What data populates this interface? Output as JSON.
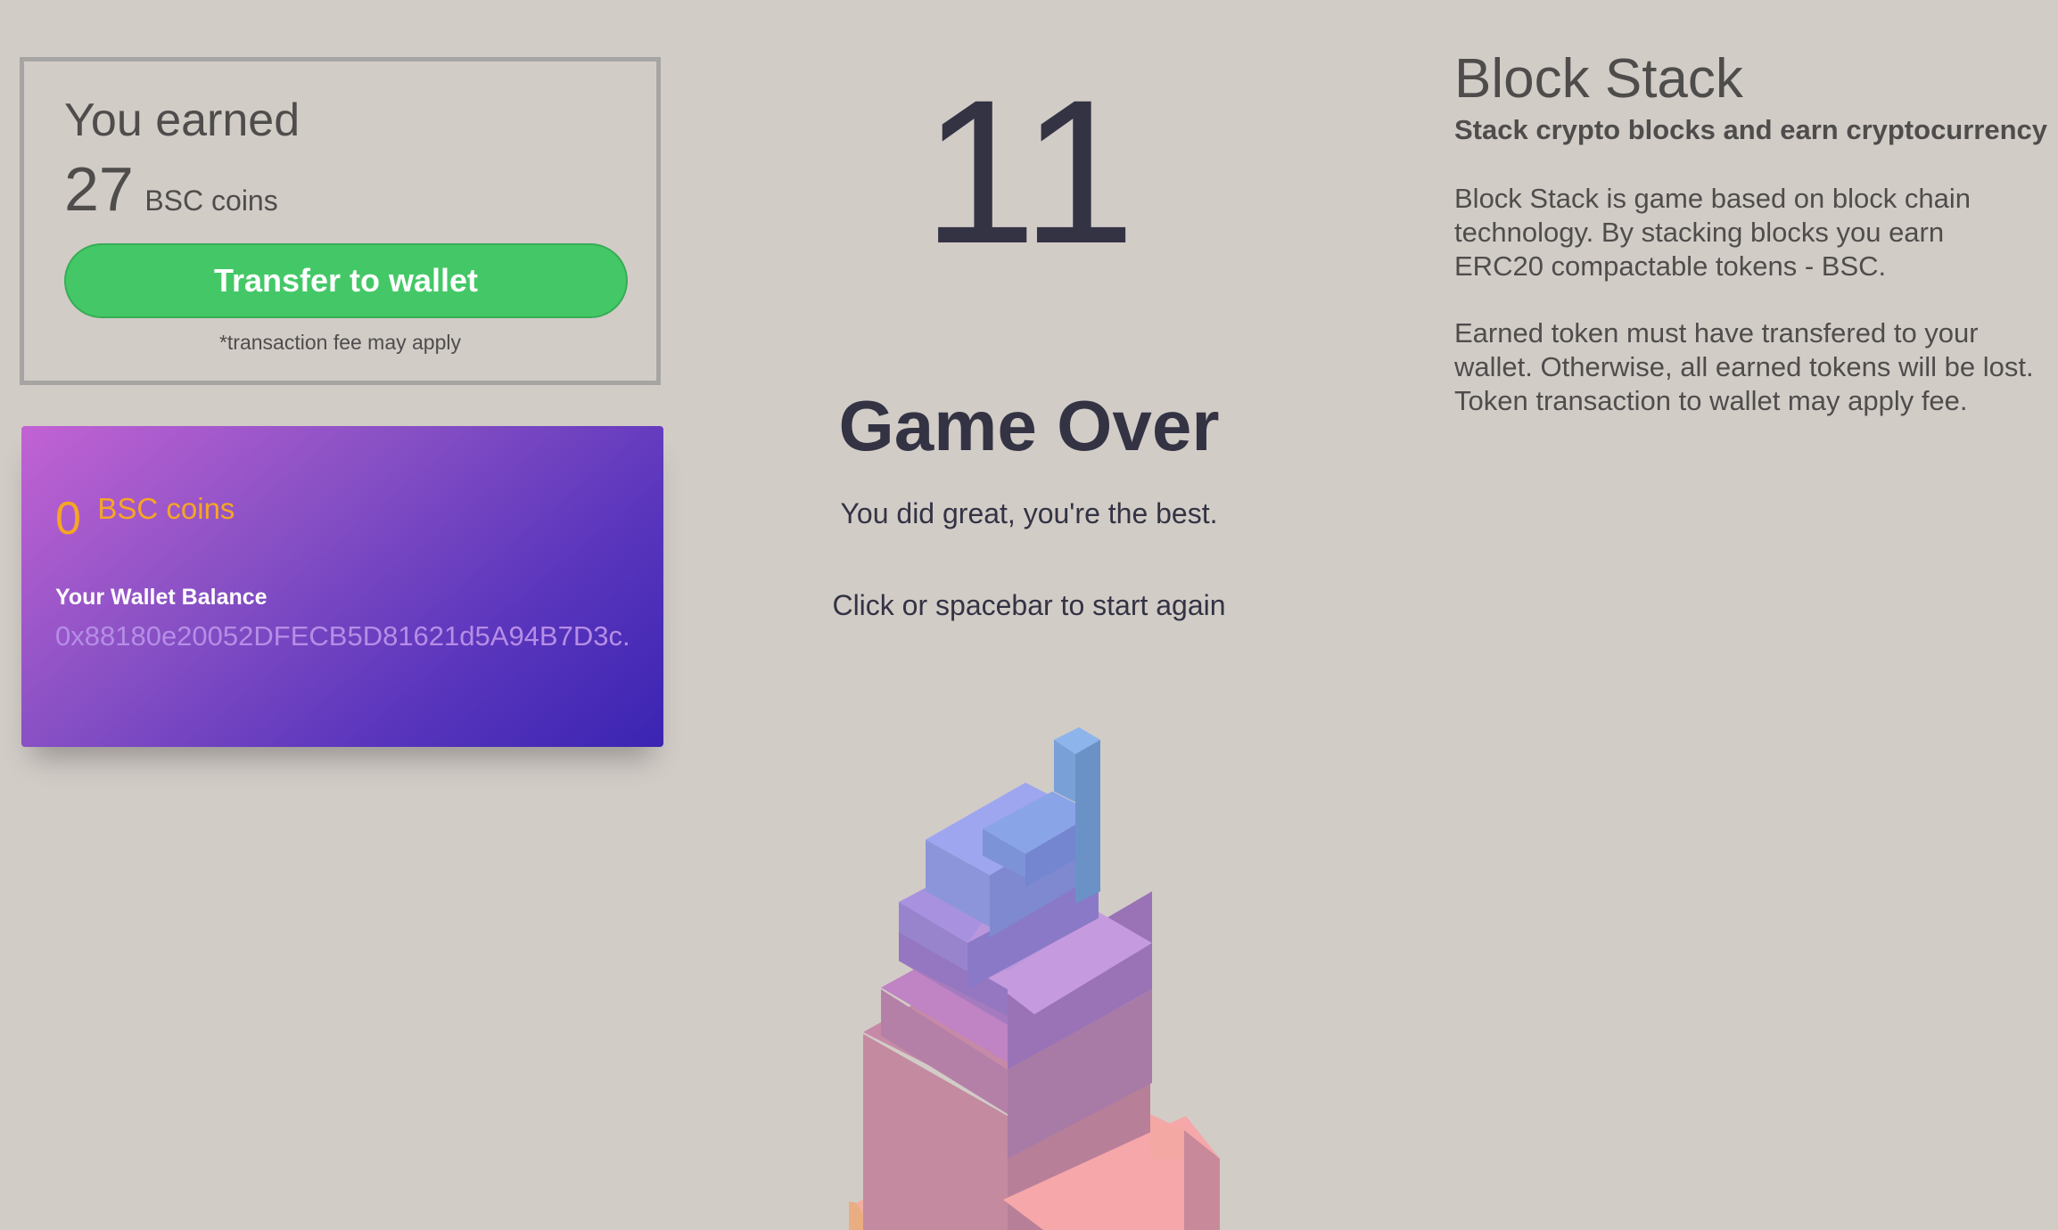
{
  "earned": {
    "title": "You earned",
    "amount": "27",
    "unit": "BSC coins",
    "transfer_button": "Transfer to wallet",
    "fee_note": "*transaction fee may apply"
  },
  "wallet": {
    "balance": "0",
    "unit": "BSC coins",
    "label": "Your Wallet Balance",
    "address": "0x88180e20052DFECB5D81621d5A94B7D3c..."
  },
  "game": {
    "score": "11",
    "status": "Game Over",
    "message": "You did great, you're the best.",
    "restart_hint": "Click or spacebar to start again"
  },
  "info": {
    "title": "Block Stack",
    "subtitle": "Stack crypto blocks and earn cryptocurrency",
    "paragraphs": [
      "Block Stack is game based on block chain technology. By stacking blocks you earn ERC20 compactable tokens - BSC.",
      "Earned token must have transfered to your wallet. Otherwise, all earned tokens will be lost. Token transaction to wallet may apply fee."
    ]
  },
  "colors": {
    "background": "#d2ccc7",
    "button_green": "#44c867",
    "coin_orange": "#f6a623",
    "score_dark": "#333344"
  }
}
